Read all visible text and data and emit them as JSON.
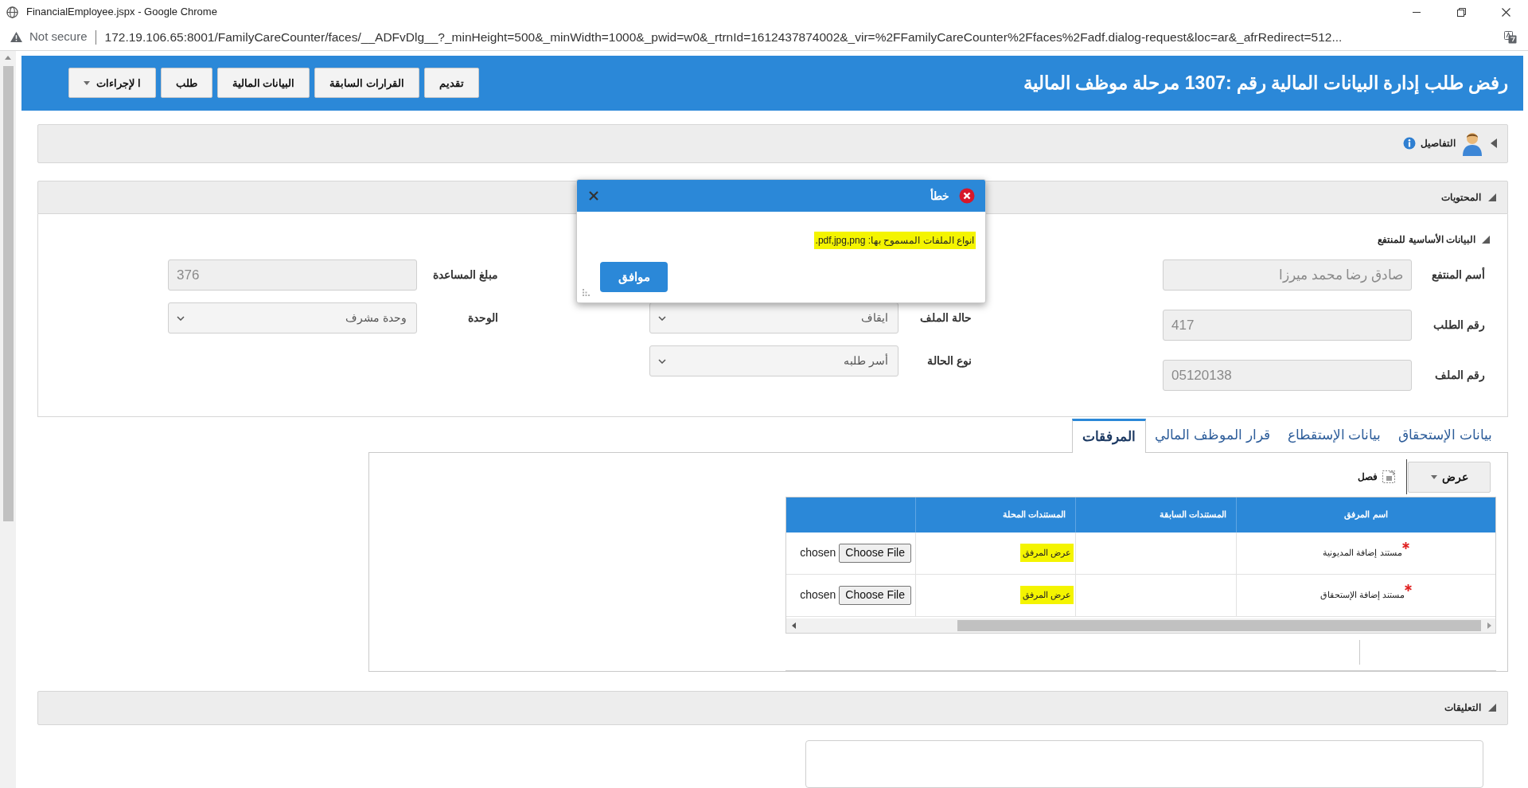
{
  "browser": {
    "title": "FinancialEmployee.jspx - Google Chrome",
    "security": "Not secure",
    "url": "172.19.106.65:8001/FamilyCareCounter/faces/__ADFvDlg__?_minHeight=500&_minWidth=1000&_pwid=w0&_rtrnId=1612437874002&_vir=%2FFamilyCareCounter%2Ffaces%2Fadf.dialog-request&loc=ar&_afrRedirect=512..."
  },
  "header": {
    "title": "رفض طلب إدارة البيانات المالية رقم :1307 مرحلة موظف المالية",
    "buttons": [
      {
        "label": "تقديم",
        "kind": "button"
      },
      {
        "label": "القرارات السابقة",
        "kind": "button"
      },
      {
        "label": "البيانات المالية",
        "kind": "button"
      },
      {
        "label": "طلب",
        "kind": "button"
      },
      {
        "label": "ا لإجراءات",
        "kind": "menu"
      }
    ]
  },
  "details": {
    "title": "التفاصيل",
    "expanded": false
  },
  "contents": {
    "title": "المحتويات",
    "expanded": true,
    "section": {
      "title": "البيانات الأساسية للمنتفع",
      "expanded": true,
      "columns": [
        {
          "fields": [
            {
              "label": "أسم المنتفع",
              "kind": "text",
              "value": "صادق رضا محمد ميرزا",
              "disabled": true
            },
            {
              "label": "رقم الطلب",
              "kind": "text",
              "value": "417",
              "disabled": true
            },
            {
              "label": "رقم الملف",
              "kind": "text",
              "value": "05120138",
              "disabled": true
            }
          ]
        },
        {
          "fields": [
            {
              "label": "حالة الملف",
              "kind": "select",
              "value": "ايقاف",
              "disabled": true
            },
            {
              "label": "نوع الحالة",
              "kind": "select",
              "value": "أسر طلبه",
              "disabled": true
            }
          ]
        },
        {
          "fields": [
            {
              "label": "مبلغ المساعدة",
              "kind": "text",
              "value": "376",
              "disabled": true
            },
            {
              "label": "الوحدة",
              "kind": "select",
              "value": "وحدة مشرف",
              "disabled": true
            }
          ]
        }
      ]
    }
  },
  "tabs": [
    {
      "label": "بيانات الإستحقاق",
      "selected": false
    },
    {
      "label": "بيانات الإستقطاع",
      "selected": false
    },
    {
      "label": "قرار الموظف المالي",
      "selected": false
    },
    {
      "label": "المرفقات",
      "selected": true
    }
  ],
  "attachments": {
    "view_menu": "عرض",
    "detach": "فصل",
    "columns": [
      "اسم المرفق",
      "المستندات السابقة",
      "المستندات المحلة"
    ],
    "rows": [
      {
        "name": "مستند إضافة المديونية",
        "required": true,
        "link": {
          "text": "عرض المرفق",
          "highlighted": true
        },
        "file_button": "Choose File",
        "file_status": "chosen"
      },
      {
        "name": "مستند إضافة الإستحقاق",
        "required": true,
        "link": {
          "text": "عرض المرفق",
          "highlighted": true
        },
        "file_button": "Choose File",
        "file_status": "chosen"
      }
    ]
  },
  "comments": {
    "title": "التعليقات",
    "expanded": true
  },
  "dialog": {
    "kind": "error",
    "title": "خطأ",
    "message": "انواع الملفات المسموح بها: pdf,jpg,png.",
    "message_highlighted": true,
    "button": "موافق"
  }
}
